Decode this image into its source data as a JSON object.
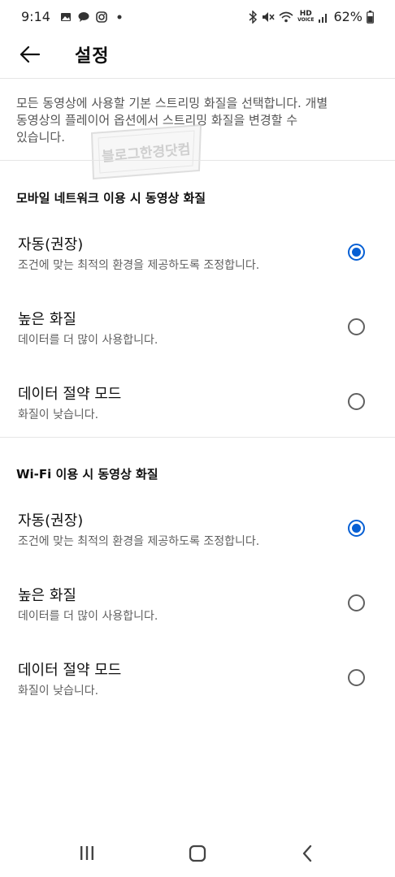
{
  "status_bar": {
    "time": "9:14",
    "battery": "62%",
    "hd_top": "HD",
    "hd_bottom": "VOICE",
    "left_icons": [
      "gallery-icon",
      "talk-icon",
      "instagram-icon",
      "dot-icon"
    ],
    "right_icons": [
      "bluetooth-icon",
      "mute-icon",
      "wifi-icon",
      "signal-icon",
      "battery-icon"
    ]
  },
  "app_bar": {
    "title": "설정"
  },
  "intro": {
    "lines": [
      "모든 동영상에 사용할 기본 스트리밍 화질을 선택합니다. 개별",
      "동영상의 플레이어 옵션에서 스트리밍 화질을 변경할 수",
      "있습니다."
    ]
  },
  "watermark": {
    "text": "블로그한경닷컴"
  },
  "mobile": {
    "section_title": "모바일 네트워크 이용 시 동영상 화질",
    "options": [
      {
        "title": "자동(권장)",
        "subtitle": "조건에 맞는 최적의 환경을 제공하도록 조정합니다.",
        "selected": true
      },
      {
        "title": "높은 화질",
        "subtitle": "데이터를 더 많이 사용합니다.",
        "selected": false
      },
      {
        "title": "데이터 절약 모드",
        "subtitle": "화질이 낮습니다.",
        "selected": false
      }
    ]
  },
  "wifi": {
    "section_title": "Wi-Fi 이용 시 동영상 화질",
    "options": [
      {
        "title": "자동(권장)",
        "subtitle": "조건에 맞는 최적의 환경을 제공하도록 조정합니다.",
        "selected": true
      },
      {
        "title": "높은 화질",
        "subtitle": "데이터를 더 많이 사용합니다.",
        "selected": false
      },
      {
        "title": "데이터 절약 모드",
        "subtitle": "화질이 낮습니다.",
        "selected": false
      }
    ]
  },
  "colors": {
    "accent": "#065fd4",
    "text_primary": "#0f0f0f",
    "text_secondary": "#606060",
    "divider": "#e6e6e6"
  },
  "nav_bar": {
    "icons": [
      "recent-apps-icon",
      "home-icon",
      "back-icon"
    ]
  }
}
